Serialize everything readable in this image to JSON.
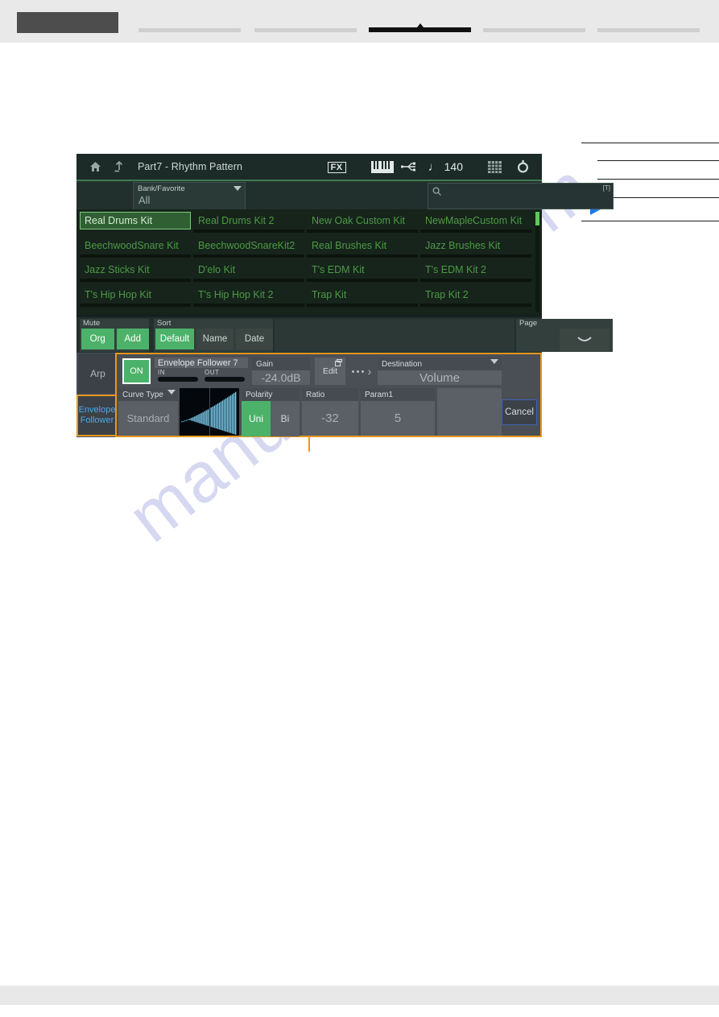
{
  "top_nav": {
    "logo_alt": "brand-logo",
    "tabs": [
      {
        "name": "nav-tab-1",
        "active": false
      },
      {
        "name": "nav-tab-2",
        "active": false
      },
      {
        "name": "nav-tab-3",
        "active": true
      },
      {
        "name": "nav-tab-4",
        "active": false
      },
      {
        "name": "nav-tab-5",
        "active": false
      }
    ]
  },
  "watermark": {
    "text": "manualshive.com"
  },
  "side_notes": {
    "marker": "play-triangle"
  },
  "device": {
    "header": {
      "home_icon": "home-icon",
      "up_icon": "exit-up-icon",
      "title": "Part7 - Rhythm Pattern",
      "fx_badge": "FX",
      "keyboard_icon": "keyboard-icon",
      "usb_icon": "usb-icon",
      "tempo_note": "♩",
      "tempo_value": "140",
      "grid_icon": "grid-icon",
      "gear_icon": "gear-icon"
    },
    "search_strip": {
      "bank_label": "Bank/Favorite",
      "bank_value": "All",
      "search_icon": "search-icon",
      "search_value": "",
      "search_placeholder": "",
      "search_corner": "[T]"
    },
    "kit_list": {
      "selected": "Real Drums Kit",
      "items": [
        "Real Drums Kit",
        "Real Drums Kit 2",
        "New Oak Custom Kit",
        "NewMapleCustom Kit",
        "BeechwoodSnare Kit",
        "BeechwoodSnareKit2",
        "Real Brushes Kit",
        "Jazz Brushes Kit",
        "Jazz Sticks Kit",
        "D'elo Kit",
        "T's EDM Kit",
        "T's EDM Kit 2",
        "T's Hip Hop Kit",
        "T's Hip Hop Kit 2",
        "Trap Kit",
        "Trap Kit 2"
      ]
    },
    "controls": {
      "mute_label": "Mute",
      "mute_buttons": [
        {
          "label": "Org",
          "on": true
        },
        {
          "label": "Add",
          "on": true
        }
      ],
      "sort_label": "Sort",
      "sort_buttons": [
        {
          "label": "Default",
          "on": true
        },
        {
          "label": "Name",
          "on": false
        },
        {
          "label": "Date",
          "on": false
        }
      ],
      "page_label": "Page",
      "page_icon": "chevron-down-icon"
    },
    "bottom_panel": {
      "tab_arp": "Arp",
      "tab_ef_line1": "Envelope",
      "tab_ef_line2": "Follower",
      "on_button": "ON",
      "ef_name": "Envelope Follower 7",
      "meter_in_label": "IN",
      "meter_out_label": "OUT",
      "gain_label": "Gain",
      "gain_value": "-24.0dB",
      "edit_label": "Edit",
      "edit_window_icon": "window-icon",
      "dots_icon": "more-dots-icon",
      "destination_label": "Destination",
      "destination_value": "Volume",
      "curve_type_label": "Curve Type",
      "curve_type_value": "Standard",
      "graph_icon": "envelope-graph",
      "polarity_label": "Polarity",
      "polarity_buttons": [
        {
          "label": "Uni",
          "on": true
        },
        {
          "label": "Bi",
          "on": false
        }
      ],
      "ratio_label": "Ratio",
      "ratio_value": "-32",
      "param1_label": "Param1",
      "param1_value": "5",
      "cancel_label": "Cancel"
    }
  },
  "colors": {
    "accent_orange": "#e8971f",
    "accent_green": "#4cb26a",
    "list_green": "#4d9a45",
    "link_blue": "#4fa8e8",
    "graph_cyan": "#79c8e8"
  }
}
